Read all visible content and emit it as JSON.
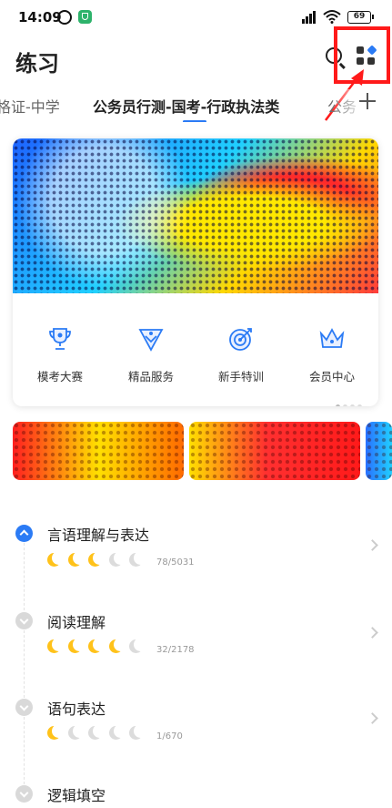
{
  "status_bar": {
    "time": "14:09",
    "battery": "69"
  },
  "header": {
    "title": "练习",
    "search_icon": "search-icon",
    "apps_icon": "apps-grid-icon",
    "highlight_color": "#ff1a1a"
  },
  "tabs": {
    "items": [
      {
        "label": "格证-中学",
        "active": false
      },
      {
        "label": "公务员行测-国考-行政执法类",
        "active": true
      },
      {
        "label": "公务",
        "active": false
      }
    ],
    "add_icon": "plus-icon",
    "accent": "#2b7bf5"
  },
  "quick_actions": [
    {
      "label": "模考大赛",
      "icon": "trophy-icon"
    },
    {
      "label": "精品服务",
      "icon": "badge-icon"
    },
    {
      "label": "新手特训",
      "icon": "target-icon"
    },
    {
      "label": "会员中心",
      "icon": "crown-icon"
    }
  ],
  "chapters": [
    {
      "title": "言语理解与表达",
      "stars_filled": 3,
      "stars_total": 5,
      "progress": "78/5031",
      "expanded": true
    },
    {
      "title": "阅读理解",
      "stars_filled": 4,
      "stars_total": 5,
      "progress": "32/2178",
      "expanded": false
    },
    {
      "title": "语句表达",
      "stars_filled": 1,
      "stars_total": 5,
      "progress": "1/670",
      "expanded": false
    },
    {
      "title": "逻辑填空",
      "expanded": false
    }
  ]
}
